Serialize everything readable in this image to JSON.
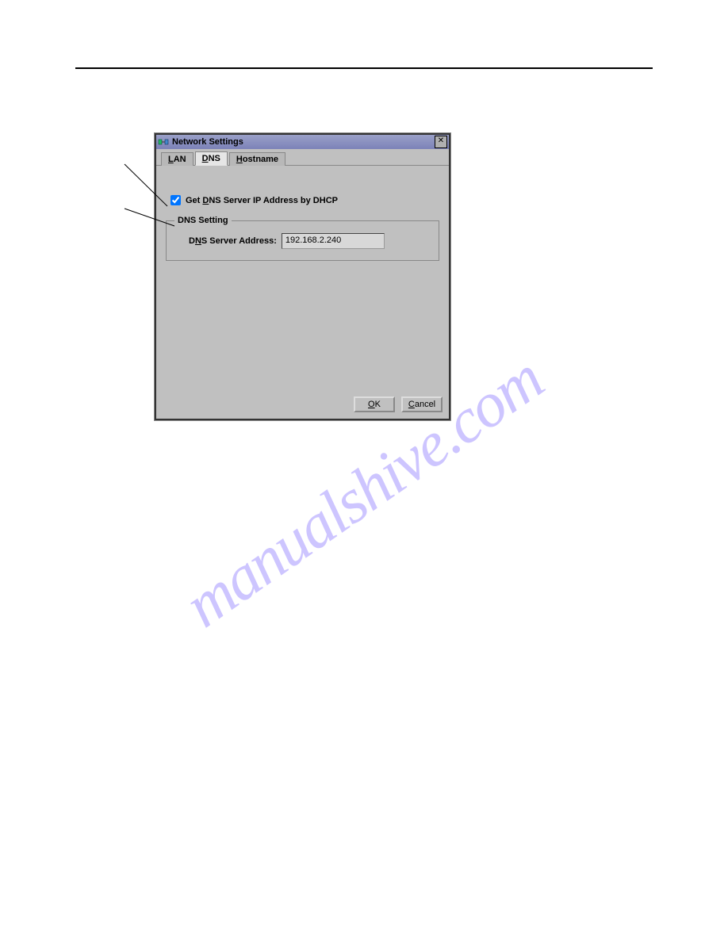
{
  "dialog": {
    "title": "Network Settings",
    "tabs": {
      "lan": "LAN",
      "dns": "DNS",
      "hostname": "Hostname"
    },
    "checkbox": {
      "checked": true,
      "label_prefix": "Get ",
      "label_mn": "D",
      "label_rest": "NS Server IP Address by DHCP"
    },
    "group": {
      "legend": "DNS Setting",
      "field_label_prefix": "D",
      "field_label_mn": "N",
      "field_label_rest": "S Server Address:",
      "value": "192.168.2.240"
    },
    "buttons": {
      "ok_mn": "O",
      "ok_rest": "K",
      "cancel_mn": "C",
      "cancel_rest": "ancel"
    },
    "close_glyph": "✕"
  },
  "watermark": "manualshive.com"
}
